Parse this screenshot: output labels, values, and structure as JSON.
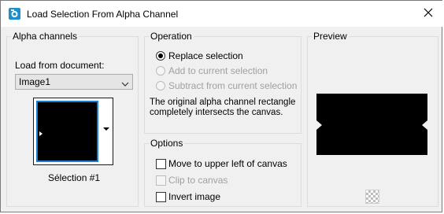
{
  "window": {
    "title": "Load Selection From Alpha Channel",
    "icon": "app-icon",
    "close_icon": "close-icon"
  },
  "alpha_channels": {
    "group_label": "Alpha channels",
    "load_from_label": "Load from document:",
    "document_selected": "Image1",
    "thumbnail_caption": "Sélection #1"
  },
  "operation": {
    "group_label": "Operation",
    "options": [
      {
        "label": "Replace selection",
        "checked": true,
        "enabled": true
      },
      {
        "label": "Add to current selection",
        "checked": false,
        "enabled": false
      },
      {
        "label": "Subtract from current selection",
        "checked": false,
        "enabled": false
      }
    ],
    "description": "The original alpha channel rectangle completely intersects the canvas."
  },
  "options": {
    "group_label": "Options",
    "items": [
      {
        "label": "Move to upper left of canvas",
        "checked": false,
        "enabled": true
      },
      {
        "label": "Clip to canvas",
        "checked": false,
        "enabled": false
      },
      {
        "label": "Invert image",
        "checked": false,
        "enabled": true
      }
    ]
  },
  "preview": {
    "group_label": "Preview",
    "background_button_icon": "checkerboard-icon"
  },
  "colors": {
    "dialog_bg": "#f0f0f0",
    "accent": "#1a7fd4",
    "group_border": "#dcdcdc",
    "disabled_text": "#a0a0a0"
  }
}
